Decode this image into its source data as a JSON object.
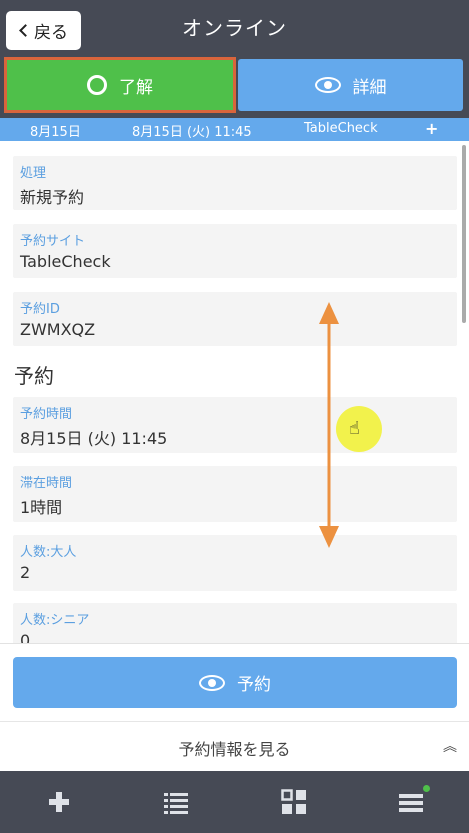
{
  "header": {
    "back_label": "戻る",
    "title": "オンライン"
  },
  "actions": {
    "acknowledge_label": "了解",
    "detail_label": "詳細"
  },
  "infobar": {
    "date": "8月15日",
    "datetime": "8月15日 (火) 11:45",
    "source": "TableCheck"
  },
  "fields": [
    {
      "label": "処理",
      "value": "新規予約"
    },
    {
      "label": "予約サイト",
      "value": "TableCheck"
    },
    {
      "label": "予約ID",
      "value": "ZWMXQZ"
    }
  ],
  "section_title": "予約",
  "reservation_fields": [
    {
      "label": "予約時間",
      "value": "8月15日 (火) 11:45"
    },
    {
      "label": "滞在時間",
      "value": "1時間"
    },
    {
      "label": "人数:大人",
      "value": "2"
    },
    {
      "label": "人数:シニア",
      "value": "0"
    }
  ],
  "bottom": {
    "reserve_label": "予約",
    "view_info_label": "予約情報を見る"
  },
  "colors": {
    "header_bg": "#464a55",
    "accent_blue": "#64a9ec",
    "ack_green": "#4fc04a",
    "ack_border": "#d9653c",
    "label_blue": "#5b9fe0",
    "arrow_orange": "#ec9140"
  },
  "icons": {
    "back": "chevron-left-icon",
    "ack": "circle-icon",
    "detail": "eye-icon",
    "add": "plus-icon",
    "list": "list-icon",
    "grid": "grid-icon",
    "menu": "menu-icon"
  }
}
